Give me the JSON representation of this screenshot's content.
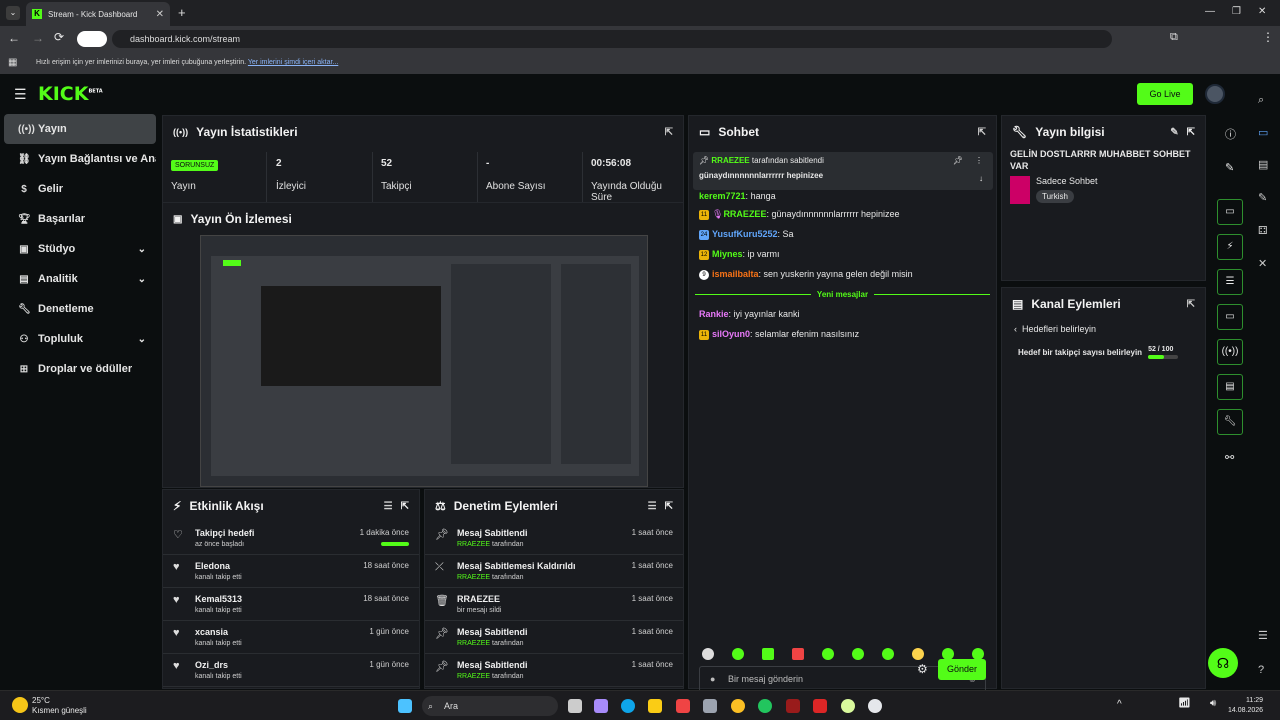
{
  "browser": {
    "tab_title": "Stream - Kick Dashboard",
    "url": "dashboard.kick.com/stream",
    "bookmarks_hint": "Hızlı erişim için yer imlerinizi buraya, yer imleri çubuğuna yerleştirin.",
    "bookmarks_link": "Yer imlerini şimdi içeri aktar..."
  },
  "header": {
    "logo": "KICK",
    "logo_sup": "BETA",
    "go_live": "Go Live"
  },
  "sidebar": {
    "items": [
      {
        "label": "Yayın",
        "icon": "broadcast-icon"
      },
      {
        "label": "Yayın Bağlantısı ve Anahtarı",
        "icon": "link-icon"
      },
      {
        "label": "Gelir",
        "icon": "dollar-icon"
      },
      {
        "label": "Başarılar",
        "icon": "trophy-icon"
      },
      {
        "label": "Stüdyo",
        "icon": "studio-icon"
      },
      {
        "label": "Analitik",
        "icon": "chart-icon"
      },
      {
        "label": "Denetleme",
        "icon": "wrench-icon"
      },
      {
        "label": "Topluluk",
        "icon": "community-icon"
      },
      {
        "label": "Droplar ve ödüller",
        "icon": "gift-icon"
      }
    ]
  },
  "stats": {
    "title": "Yayın İstatistikleri",
    "status_badge": "SORUNSUZ",
    "status_label": "Yayın",
    "viewers_value": "2",
    "viewers_label": "İzleyici",
    "followers_value": "52",
    "followers_label": "Takipçi",
    "subs_value": "-",
    "subs_label": "Abone Sayısı",
    "duration_value": "00:56:08",
    "duration_label": "Yayında Olduğu Süre"
  },
  "preview": {
    "title": "Yayın Ön İzlemesi"
  },
  "activity": {
    "title": "Etkinlik Akışı",
    "rows": [
      {
        "title": "Takipçi hedefi",
        "sub": "az önce başladı",
        "time": "1 dakika önce"
      },
      {
        "title": "Eledona",
        "sub": "kanalı takip etti",
        "time": "18 saat önce"
      },
      {
        "title": "Kemal5313",
        "sub": "kanalı takip etti",
        "time": "18 saat önce"
      },
      {
        "title": "xcansia",
        "sub": "kanalı takip etti",
        "time": "1 gün önce"
      },
      {
        "title": "Ozi_drs",
        "sub": "kanalı takip etti",
        "time": "1 gün önce"
      }
    ]
  },
  "moderation": {
    "title": "Denetim Eylemleri",
    "rows": [
      {
        "title": "Mesaj Sabitlendi",
        "user": "RRAEZEE",
        "sub": "tarafından",
        "time": "1 saat önce"
      },
      {
        "title": "Mesaj Sabitlemesi Kaldırıldı",
        "user": "RRAEZEE",
        "sub": "tarafından",
        "time": "1 saat önce"
      },
      {
        "title": "RRAEZEE",
        "user": "",
        "sub": "bir mesajı sildi",
        "time": "1 saat önce"
      },
      {
        "title": "Mesaj Sabitlendi",
        "user": "RRAEZEE",
        "sub": "tarafından",
        "time": "1 saat önce"
      },
      {
        "title": "Mesaj Sabitlendi",
        "user": "RRAEZEE",
        "sub": "tarafından",
        "time": "1 saat önce"
      }
    ]
  },
  "chat": {
    "title": "Sohbet",
    "pinned_by": "RRAEZEE",
    "pinned_suffix": "tarafından sabitlendi",
    "pinned_text": "günaydınnnnnnlarrrrrr hepinizee",
    "messages": [
      {
        "user": "kerem7721",
        "text": "hanga",
        "color": "#53fc18"
      },
      {
        "user": "RRAEZEE",
        "text": "günaydınnnnnnlarrrrrr hepinizee",
        "color": "#53fc18"
      },
      {
        "user": "YusufKuru5252",
        "text": "Sa",
        "color": "#60a5fa"
      },
      {
        "user": "Miynes",
        "text": "ip varmı",
        "color": "#53fc18"
      },
      {
        "user": "ismailbalta",
        "text": "sen yuskerin yayına gelen değil misin",
        "color": "#f97316"
      }
    ],
    "new_messages": "Yeni mesajlar",
    "new": [
      {
        "user": "Rankie",
        "text": "iyi yayınlar kanki",
        "color": "#e879f9"
      },
      {
        "user": "silOyun0",
        "text": "selamlar efenim nasılsınız",
        "color": "#e879f9"
      }
    ],
    "input_placeholder": "Bir mesaj gönderin",
    "send": "Gönder"
  },
  "stream_info": {
    "title": "Yayın bilgisi",
    "stream_title": "GELİN DOSTLARRR MUHABBET SOHBET VAR",
    "category": "Sadece Sohbet",
    "tag": "Turkish"
  },
  "channel_actions": {
    "title": "Kanal Eylemleri",
    "back_label": "Hedefleri belirleyin",
    "goal_label": "Hedef bir takipçi sayısı belirleyin",
    "goal_value": "52 / 100",
    "goal_progress": 0.52
  },
  "taskbar": {
    "weather_temp": "25°C",
    "weather_desc": "Kısmen güneşli",
    "search": "Ara",
    "time": "11:29",
    "date": "14.08.2026"
  },
  "colors": {
    "accent": "#53fc18",
    "panel": "#191b1f",
    "bg": "#0b0e0f"
  }
}
